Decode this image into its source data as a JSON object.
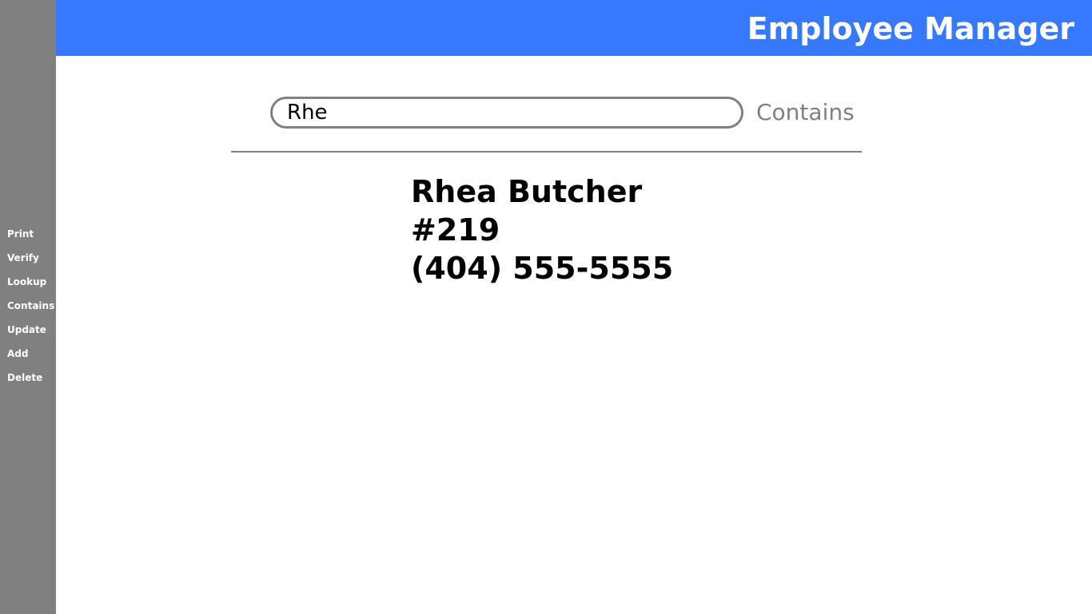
{
  "header": {
    "title": "Employee Manager"
  },
  "sidebar": {
    "items": [
      {
        "label": "Print"
      },
      {
        "label": "Verify"
      },
      {
        "label": "Lookup"
      },
      {
        "label": "Contains"
      },
      {
        "label": "Update"
      },
      {
        "label": "Add"
      },
      {
        "label": "Delete"
      }
    ]
  },
  "search": {
    "value": "Rhe",
    "mode_label": "Contains"
  },
  "result": {
    "name": "Rhea Butcher",
    "id": "#219",
    "phone": "(404) 555-5555"
  },
  "colors": {
    "header_bg": "#3779fc",
    "sidebar_bg": "#808080",
    "muted_text": "#808080"
  }
}
